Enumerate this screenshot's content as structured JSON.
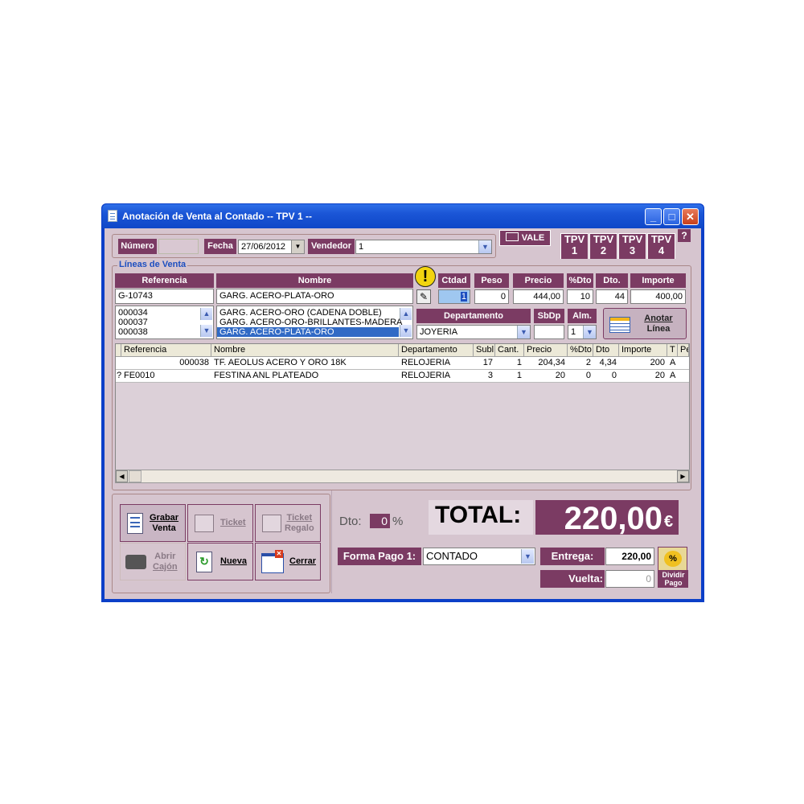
{
  "window": {
    "title": "Anotación de Venta al Contado -- TPV 1 --",
    "controls": {
      "minimize": "_",
      "maximize": "□",
      "close": "✕"
    }
  },
  "header": {
    "numero_label": "Número",
    "numero_value": "",
    "fecha_label": "Fecha",
    "fecha_value": "27/06/2012",
    "vendedor_label": "Vendedor",
    "vendedor_value": "1",
    "vale_label": "VALE",
    "tpv_tabs": [
      {
        "top": "TPV",
        "bottom": "1"
      },
      {
        "top": "TPV",
        "bottom": "2"
      },
      {
        "top": "TPV",
        "bottom": "3"
      },
      {
        "top": "TPV",
        "bottom": "4"
      }
    ],
    "help": "?"
  },
  "lineas": {
    "group_title": "Líneas de Venta",
    "labels": {
      "referencia": "Referencia",
      "nombre": "Nombre",
      "ctdad": "Ctdad",
      "peso": "Peso",
      "precio": "Precio",
      "dto_pct": "%Dto",
      "dto": "Dto.",
      "importe": "Importe",
      "departamento": "Departamento",
      "sbdp": "SbDp",
      "alm": "Alm."
    },
    "values": {
      "referencia": "G-10743",
      "nombre": "GARG. ACERO-PLATA-ORO",
      "ctdad": "1",
      "peso": "0",
      "precio": "444,00",
      "dto_pct": "10",
      "dto": "44",
      "importe": "400,00",
      "departamento": "JOYERIA",
      "sbdp": "",
      "alm": "1"
    },
    "ref_list": [
      "000034",
      "000037",
      "000038"
    ],
    "name_list": [
      "GARG. ACERO-ORO (CADENA DOBLE)",
      "GARG. ACERO-ORO-BRILLANTES-MADERA",
      "GARG. ACERO-PLATA-ORO"
    ],
    "anotar_label_1": "Anotar",
    "anotar_label_2": "Línea"
  },
  "table": {
    "columns": [
      "Referencia",
      "Nombre",
      "Departamento",
      "Subl",
      "Cant.",
      "Precio",
      "%Dto",
      "Dto",
      "Importe",
      "T",
      "Pe"
    ],
    "rows": [
      {
        "marker": "",
        "ref": "000038",
        "nombre": "TF. AEOLUS ACERO Y ORO 18K",
        "dep": "RELOJERIA",
        "subl": "17",
        "cant": "1",
        "precio": "204,34",
        "dto_pct": "2",
        "dto": "4,34",
        "importe": "200",
        "t": "A"
      },
      {
        "marker": "?",
        "ref": "FE0010",
        "nombre": "FESTINA ANL PLATEADO",
        "dep": "RELOJERIA",
        "subl": "3",
        "cant": "1",
        "precio": "20",
        "dto_pct": "0",
        "dto": "0",
        "importe": "20",
        "t": "A"
      }
    ]
  },
  "buttons": {
    "grabar_1": "Grabar",
    "grabar_2": "Venta",
    "ticket": "Ticket",
    "ticket_regalo_1": "Ticket",
    "ticket_regalo_2": "Regalo",
    "abrir_1": "Abrir",
    "abrir_2": "Cajón",
    "nueva": "Nueva",
    "cerrar": "Cerrar"
  },
  "totals": {
    "dto_label": "Dto:",
    "dto_value": "0",
    "pct": "%",
    "total_label": "TOTAL:",
    "total_value": "220,00",
    "currency": "€",
    "forma_pago_label": "Forma Pago 1:",
    "forma_pago_value": "CONTADO",
    "entrega_label": "Entrega:",
    "entrega_value": "220,00",
    "vuelta_label": "Vuelta:",
    "vuelta_value": "0",
    "dividir_1": "Dividir",
    "dividir_2": "Pago",
    "dividir_pct": "%"
  },
  "colors": {
    "accent": "#7b3b63",
    "background": "#d6c5cf",
    "titlebar": "#1a55d6"
  }
}
